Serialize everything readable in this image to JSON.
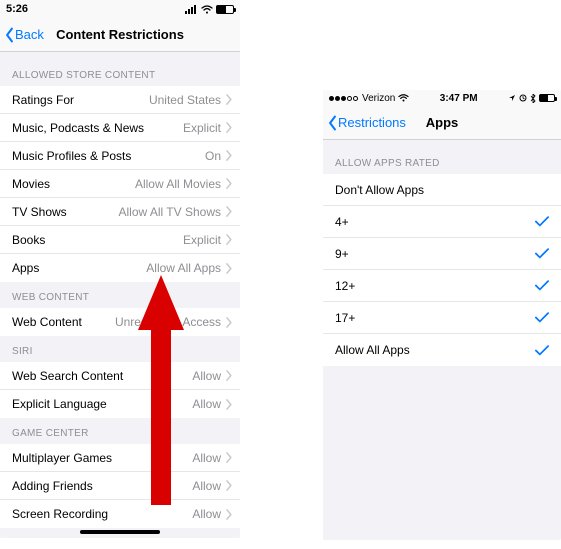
{
  "left": {
    "status": {
      "time": "5:26"
    },
    "nav": {
      "back": "Back",
      "title": "Content Restrictions"
    },
    "sections": {
      "allowed_store": {
        "header": "ALLOWED STORE CONTENT",
        "rows": [
          {
            "label": "Ratings For",
            "value": "United States"
          },
          {
            "label": "Music, Podcasts & News",
            "value": "Explicit"
          },
          {
            "label": "Music Profiles & Posts",
            "value": "On"
          },
          {
            "label": "Movies",
            "value": "Allow All Movies"
          },
          {
            "label": "TV Shows",
            "value": "Allow All TV Shows"
          },
          {
            "label": "Books",
            "value": "Explicit"
          },
          {
            "label": "Apps",
            "value": "Allow All Apps"
          }
        ]
      },
      "web_content": {
        "header": "WEB CONTENT",
        "rows": [
          {
            "label": "Web Content",
            "value": "Unrestricted Access"
          }
        ]
      },
      "siri": {
        "header": "SIRI",
        "rows": [
          {
            "label": "Web Search Content",
            "value": "Allow"
          },
          {
            "label": "Explicit Language",
            "value": "Allow"
          }
        ]
      },
      "game_center": {
        "header": "GAME CENTER",
        "rows": [
          {
            "label": "Multiplayer Games",
            "value": "Allow"
          },
          {
            "label": "Adding Friends",
            "value": "Allow"
          },
          {
            "label": "Screen Recording",
            "value": "Allow"
          }
        ]
      }
    }
  },
  "right": {
    "status": {
      "carrier": "Verizon",
      "time": "3:47 PM"
    },
    "nav": {
      "back": "Restrictions",
      "title": "Apps"
    },
    "section": {
      "header": "ALLOW APPS RATED",
      "rows": [
        {
          "label": "Don't Allow Apps",
          "checked": false
        },
        {
          "label": "4+",
          "checked": true
        },
        {
          "label": "9+",
          "checked": true
        },
        {
          "label": "12+",
          "checked": true
        },
        {
          "label": "17+",
          "checked": true
        },
        {
          "label": "Allow All Apps",
          "checked": true
        }
      ]
    }
  },
  "colors": {
    "accent": "#007aff",
    "arrow": "#d90000"
  }
}
